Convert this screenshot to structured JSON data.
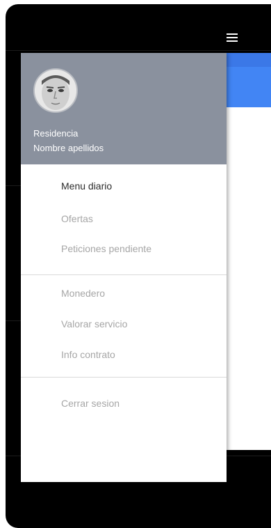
{
  "header": {
    "line1": "Residencia",
    "line2": "Nombre apellidos"
  },
  "menu": {
    "group1": [
      {
        "label": "Menu diario",
        "active": true
      },
      {
        "label": "Ofertas",
        "active": false
      },
      {
        "label": "Peticiones pendiente",
        "active": false
      }
    ],
    "group2": [
      {
        "label": "Monedero",
        "active": false
      },
      {
        "label": "Valorar servicio",
        "active": false
      },
      {
        "label": "Info contrato",
        "active": false
      }
    ],
    "group3": [
      {
        "label": "Cerrar sesion",
        "active": false
      }
    ]
  },
  "colors": {
    "header_bg": "#8a919e",
    "toolbar": "#4285f4",
    "active_text": "#2b2b2b",
    "inactive_text": "#a6a6a6"
  },
  "icons": {
    "menu": "hamburger-icon",
    "avatar": "user-avatar"
  }
}
